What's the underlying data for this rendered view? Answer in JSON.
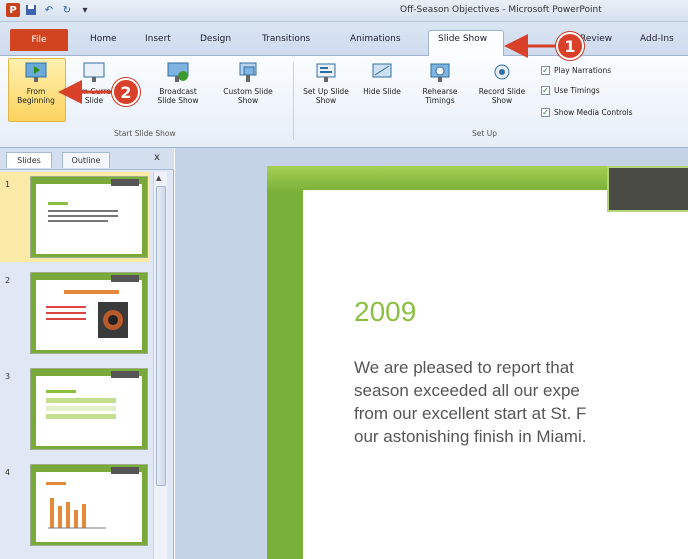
{
  "window": {
    "title": "Off-Season Objectives - Microsoft PowerPoint"
  },
  "tabs": [
    "File",
    "Home",
    "Insert",
    "Design",
    "Transitions",
    "Animations",
    "Slide Show",
    "Review",
    "Add-Ins"
  ],
  "ribbon": {
    "start_group": "Start Slide Show",
    "setup_group": "Set Up",
    "buttons": {
      "from_beginning": "From Beginning",
      "from_current": "From Current Slide",
      "broadcast": "Broadcast Slide Show",
      "custom": "Custom Slide Show",
      "setup": "Set Up Slide Show",
      "hide": "Hide Slide",
      "rehearse": "Rehearse Timings",
      "record": "Record Slide Show"
    },
    "checks": [
      "Play Narrations",
      "Use Timings",
      "Show Media Controls"
    ]
  },
  "pane": {
    "tab_slides": "Slides",
    "tab_outline": "Outline",
    "close": "x"
  },
  "slides": [
    "1",
    "2",
    "3",
    "4"
  ],
  "slide_content": {
    "year": "2009",
    "lines": [
      "We are pleased to report that",
      "season exceeded all our expe",
      "from our excellent start at St. F",
      "our astonishing finish in Miami."
    ]
  },
  "callouts": [
    "1",
    "2"
  ],
  "colors": {
    "accent": "#d8402a",
    "slide_green": "#79b03a",
    "file_tab": "#d2431f"
  }
}
